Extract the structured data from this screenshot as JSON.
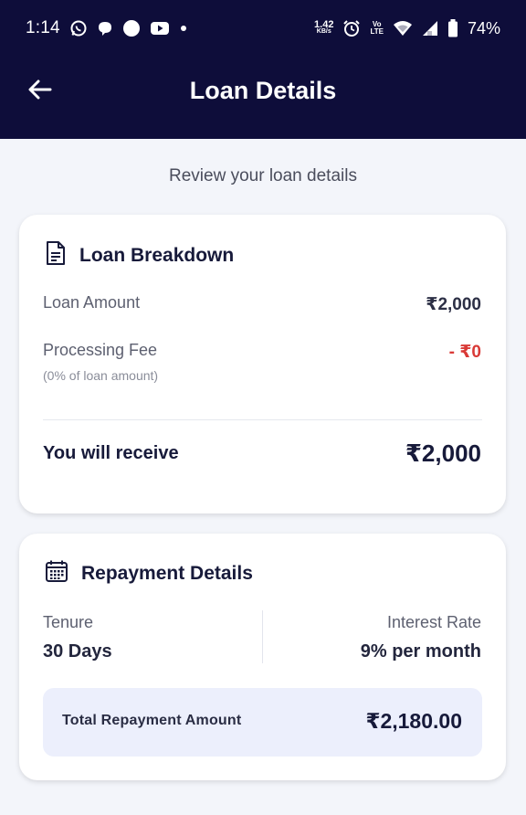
{
  "status_bar": {
    "time": "1:14",
    "net_speed_top": "1.42",
    "net_speed_bottom": "KB/s",
    "volte_top": "Vo",
    "volte_bottom": "LTE",
    "battery": "74%"
  },
  "header": {
    "title": "Loan Details"
  },
  "subtitle": "Review your loan details",
  "loan_breakdown": {
    "title": "Loan Breakdown",
    "loan_amount_label": "Loan Amount",
    "loan_amount_value": "₹2,000",
    "processing_fee_label": "Processing Fee",
    "processing_fee_value": "- ₹0",
    "processing_fee_note": "(0% of loan amount)",
    "receive_label": "You will receive",
    "receive_value": "₹2,000"
  },
  "repayment": {
    "title": "Repayment Details",
    "tenure_label": "Tenure",
    "tenure_value": "30 Days",
    "interest_label": "Interest Rate",
    "interest_value": "9% per month",
    "total_label": "Total Repayment Amount",
    "total_value": "₹2,180.00"
  },
  "colors": {
    "header_bg": "#0e0d3a",
    "page_bg": "#f3f5fa",
    "fee_red": "#d93a37",
    "total_box_bg": "#eceffc"
  },
  "icons": [
    "whatsapp-icon",
    "chat-icon",
    "circle-icon",
    "youtube-icon",
    "alarm-icon",
    "wifi-icon",
    "signal-icon",
    "battery-icon",
    "back-arrow-icon",
    "document-icon",
    "calendar-icon"
  ]
}
